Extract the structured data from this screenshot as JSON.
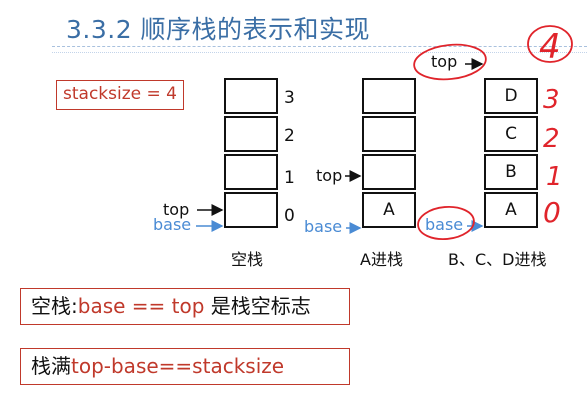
{
  "title": "3.3.2 顺序栈的表示和实现",
  "stacksize_label": "stacksize = 4",
  "stack_indices": [
    "3",
    "2",
    "1",
    "0"
  ],
  "pointer_labels": {
    "top": "top",
    "base": "base"
  },
  "stacks": [
    {
      "caption": "空栈",
      "cells": [
        "",
        "",
        "",
        ""
      ]
    },
    {
      "caption": "A进栈",
      "cells": [
        "",
        "",
        "",
        "A"
      ]
    },
    {
      "caption": "B、C、D进栈",
      "cells": [
        "D",
        "C",
        "B",
        "A"
      ]
    }
  ],
  "handwritten": {
    "circled_number": "4",
    "digits": [
      "3",
      "2",
      "1",
      "0"
    ]
  },
  "notes": {
    "empty_prefix": "空栈:",
    "empty_expr": "base == top",
    "empty_suffix": " 是栈空标志",
    "full_prefix": "栈满",
    "full_expr": "top-base==stacksize"
  },
  "colors": {
    "title": "#3a6ea5",
    "accent_red": "#c0392b",
    "base_blue": "#4a8bd4",
    "handwriting": "#e0242b"
  }
}
